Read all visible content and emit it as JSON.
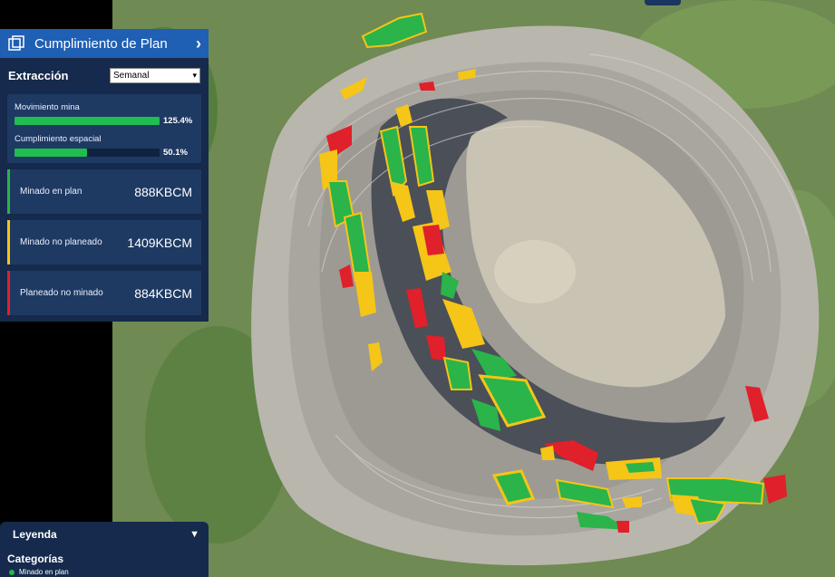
{
  "panel": {
    "title": "Cumplimiento de Plan",
    "section_label": "Extracción",
    "period_select": "Semanal",
    "progress": [
      {
        "label": "Movimiento mina",
        "percent_text": "125.4%",
        "fill_fraction": 1.0
      },
      {
        "label": "Cumplimiento espacial",
        "percent_text": "50.1%",
        "fill_fraction": 0.501
      }
    ],
    "stats": [
      {
        "label": "Minado en plan",
        "value": "888KBCM",
        "color": "#2ab44a"
      },
      {
        "label": "Minado no planeado",
        "value": "1409KBCM",
        "color": "#f5c518"
      },
      {
        "label": "Planeado no minado",
        "value": "884KBCM",
        "color": "#e0202a"
      }
    ]
  },
  "legend": {
    "title": "Leyenda",
    "subtitle": "Categorías",
    "items": [
      {
        "label": "Minado en plan",
        "color": "#2ab44a"
      }
    ]
  },
  "colors": {
    "green": "#2ab44a",
    "yellow": "#f5c518",
    "red": "#e0202a",
    "panel": "#152a4c",
    "header": "#1f5fb4"
  }
}
